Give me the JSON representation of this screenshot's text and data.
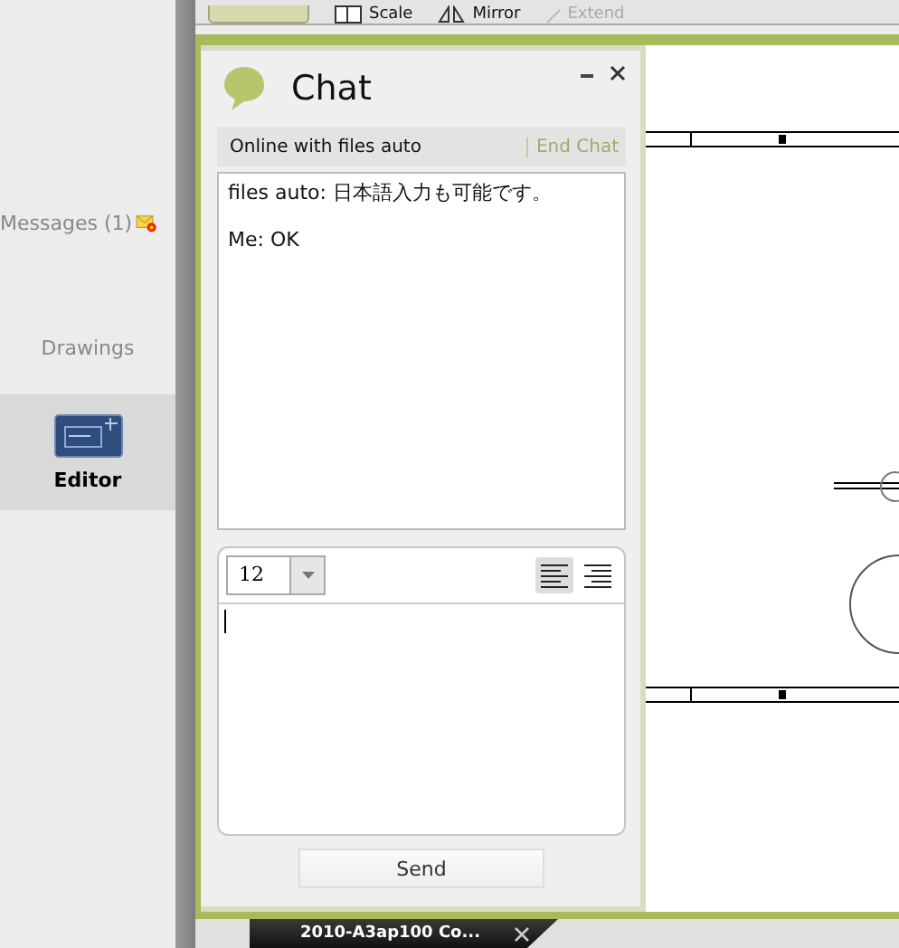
{
  "toolbar": {
    "items": [
      {
        "label": "Scale",
        "kind": "scale",
        "disabled": false
      },
      {
        "label": "Mirror",
        "kind": "mirror",
        "disabled": false
      },
      {
        "label": "Extend",
        "kind": "extend",
        "disabled": true
      }
    ]
  },
  "sidebar": {
    "items": [
      {
        "label": "Messages (1)",
        "kind": "messages",
        "selected": false
      },
      {
        "label": "Drawings",
        "kind": "drawings",
        "selected": false
      },
      {
        "label": "Editor",
        "kind": "editor",
        "selected": true
      }
    ]
  },
  "chat": {
    "title": "Chat",
    "status": "Online with files auto",
    "end_chat": "End Chat",
    "messages": [
      {
        "text": "files auto: 日本語入力も可能です。"
      },
      {
        "text": "Me: OK"
      }
    ],
    "font_size": "12",
    "align": [
      {
        "kind": "left",
        "selected": true
      },
      {
        "kind": "right",
        "selected": false
      }
    ],
    "send": "Send"
  },
  "document_tab": {
    "title": "2010-A3ap100 Co..."
  }
}
